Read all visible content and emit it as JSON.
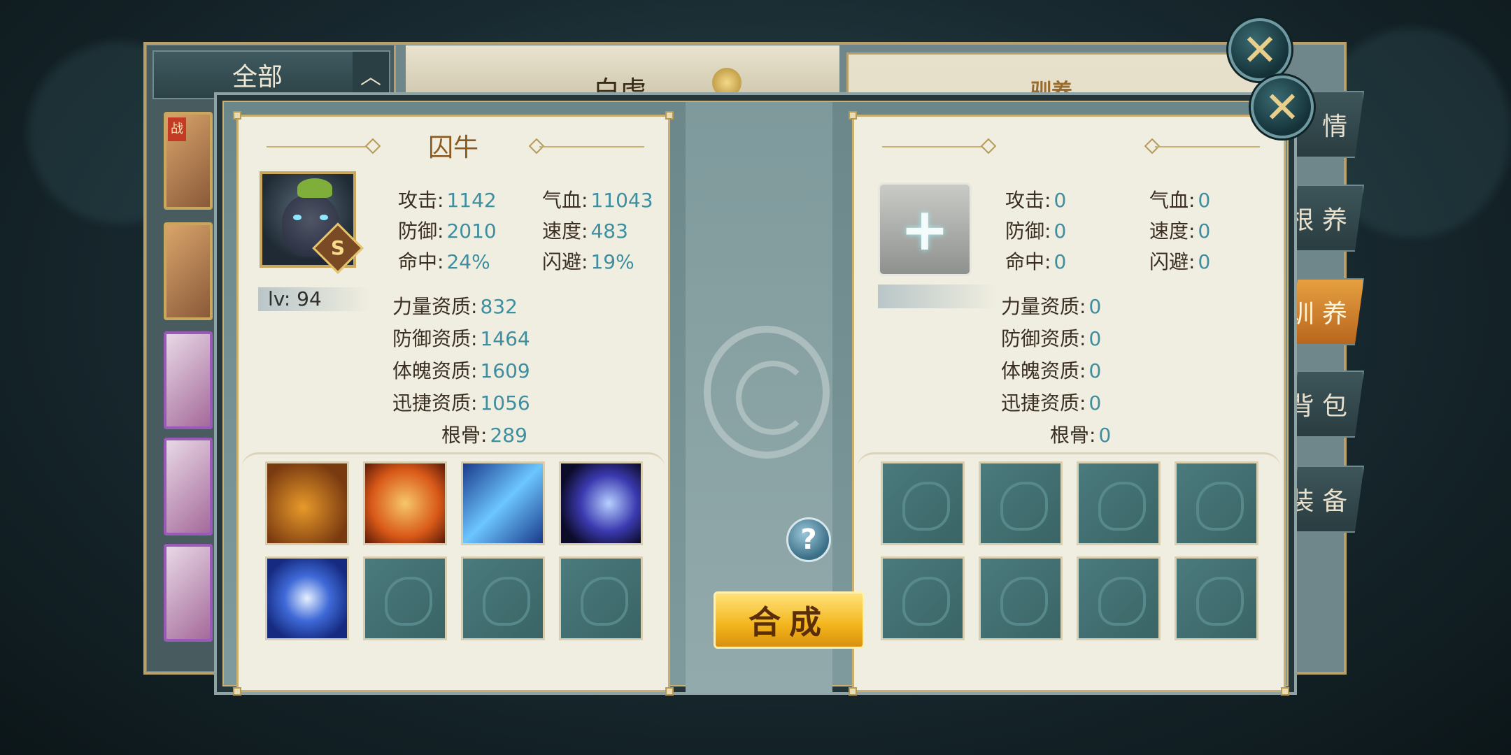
{
  "background": {
    "list_filter_label": "全部",
    "pet_name": "白虎",
    "right_title": "驯养",
    "war_tag": "战",
    "side_tabs": [
      {
        "label": "情",
        "active": false
      },
      {
        "label": "根 养",
        "active": false
      },
      {
        "label": "训 养",
        "active": true
      },
      {
        "label": "背 包",
        "active": false
      },
      {
        "label": "装 备",
        "active": false
      }
    ]
  },
  "left_card": {
    "title": "囚牛",
    "rank": "S",
    "level_label": "lv: 94",
    "stats": {
      "attack_label": "攻击:",
      "attack": "1142",
      "hp_label": "气血:",
      "hp": "11043",
      "defense_label": "防御:",
      "defense": "2010",
      "speed_label": "速度:",
      "speed": "483",
      "hit_label": "命中:",
      "hit": "24%",
      "dodge_label": "闪避:",
      "dodge": "19%"
    },
    "aptitudes": {
      "strength_label": "力量资质:",
      "strength": "832",
      "defense_label": "防御资质:",
      "defense": "1464",
      "physique_label": "体魄资质:",
      "physique": "1609",
      "agility_label": "迅捷资质:",
      "agility": "1056",
      "bone_label": "根骨:",
      "bone": "289"
    },
    "skills": [
      "roaring-beast-skill-icon",
      "flame-shield-skill-icon",
      "lightning-slash-skill-icon",
      "claw-strike-skill-icon",
      "vortex-skill-icon",
      "empty",
      "empty",
      "empty"
    ]
  },
  "right_card": {
    "add_icon": "plus-icon",
    "stats": {
      "attack_label": "攻击:",
      "attack": "0",
      "hp_label": "气血:",
      "hp": "0",
      "defense_label": "防御:",
      "defense": "0",
      "speed_label": "速度:",
      "speed": "0",
      "hit_label": "命中:",
      "hit": "0",
      "dodge_label": "闪避:",
      "dodge": "0"
    },
    "aptitudes": {
      "strength_label": "力量资质:",
      "strength": "0",
      "defense_label": "防御资质:",
      "defense": "0",
      "physique_label": "体魄资质:",
      "physique": "0",
      "agility_label": "迅捷资质:",
      "agility": "0",
      "bone_label": "根骨:",
      "bone": "0"
    },
    "skills": [
      "empty",
      "empty",
      "empty",
      "empty",
      "empty",
      "empty",
      "empty",
      "empty"
    ]
  },
  "actions": {
    "help_label": "?",
    "compose_label": "合成",
    "close_label": "✕"
  },
  "colors": {
    "accent_gold": "#c9b071",
    "value_teal": "#3e8ea0",
    "button_yellow": "#f3b51c"
  }
}
